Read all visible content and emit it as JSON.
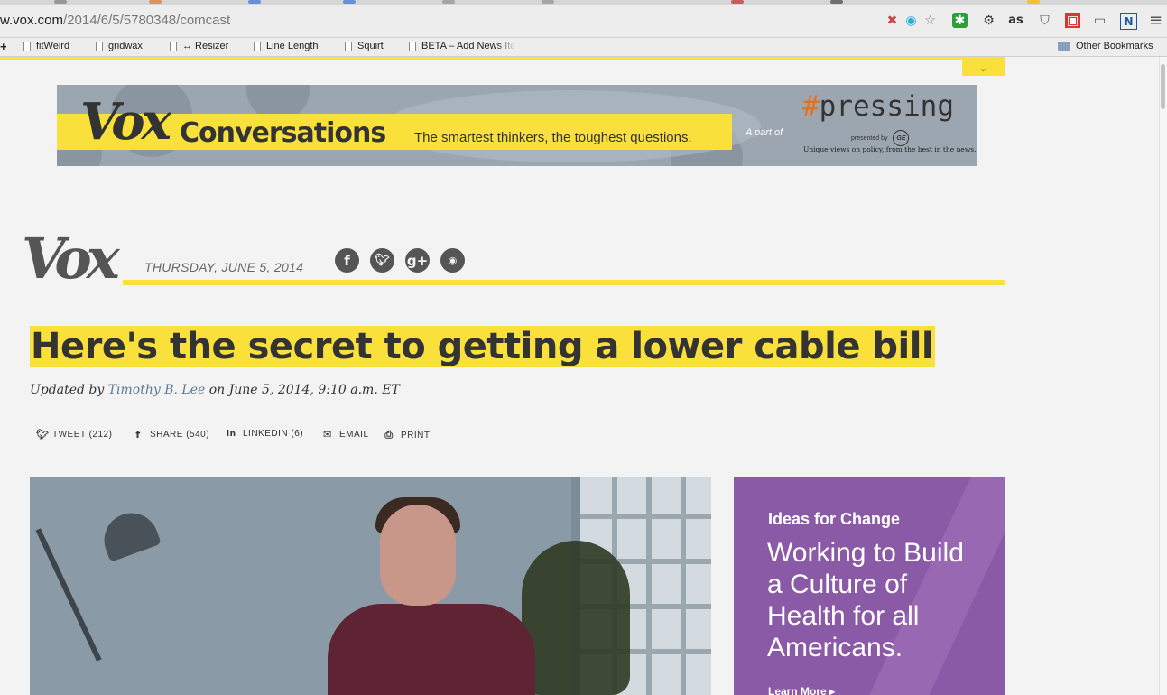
{
  "browser": {
    "url_host": "w.vox.com",
    "url_path": "/2014/6/5/5780348/comcast",
    "tab_colors": [
      "#888888",
      "#e08040",
      "#4a7fd8",
      "#4a7fd8",
      "#999999",
      "#999999",
      "#c04040",
      "#555555",
      "#f0c000"
    ],
    "extensions": [
      {
        "name": "blocked-icon",
        "glyph": "✖",
        "color": "#c44"
      },
      {
        "name": "circle-o-icon",
        "glyph": "◉",
        "color": "#2aa8e0"
      },
      {
        "name": "star-icon",
        "glyph": "☆",
        "color": "#777"
      },
      {
        "name": "evernote-icon",
        "glyph": "✱",
        "color": "#2f9e3a"
      },
      {
        "name": "gear-icon",
        "glyph": "⚙",
        "color": "#333"
      },
      {
        "name": "lastfm-icon",
        "glyph": "as",
        "color": "#333"
      },
      {
        "name": "pocket-icon",
        "glyph": "⛉",
        "color": "#555"
      },
      {
        "name": "red-square-icon",
        "glyph": "▣",
        "color": "#d33"
      },
      {
        "name": "cast-icon",
        "glyph": "▭",
        "color": "#555"
      },
      {
        "name": "n-icon",
        "glyph": "N",
        "color": "#1a56a8"
      },
      {
        "name": "menu-icon",
        "glyph": "≡",
        "color": "#555"
      }
    ],
    "bookmarks": [
      {
        "label": "fitWeird",
        "icon": "page"
      },
      {
        "label": "gridwax",
        "icon": "page"
      },
      {
        "label": "↔ Resizer",
        "icon": "page"
      },
      {
        "label": "Line Length",
        "icon": "page"
      },
      {
        "label": "Squirt",
        "icon": "page"
      },
      {
        "label": "BETA – Add News Ite",
        "icon": "page"
      }
    ],
    "other_bookmarks": "Other Bookmarks",
    "add_glyph": "+"
  },
  "banner": {
    "logo": "Vox",
    "title": "Conversations",
    "tagline": "The smartest thinkers, the toughest questions.",
    "part_of": "A part of",
    "pressing_hash": "#",
    "pressing_word": "pressing",
    "presented_by": "presented by",
    "sponsor_mark": "GE",
    "unique": "Unique views on policy, from the best in the news."
  },
  "masthead": {
    "logo": "Vox",
    "date": "THURSDAY, JUNE 5, 2014",
    "social": [
      {
        "name": "facebook-icon",
        "glyph": "f"
      },
      {
        "name": "twitter-icon",
        "glyph": "🐦︎"
      },
      {
        "name": "googleplus-icon",
        "glyph": "g+"
      },
      {
        "name": "rss-icon",
        "glyph": "◉"
      }
    ],
    "toggle_glyph": "⌄"
  },
  "article": {
    "headline": "Here's the secret to getting a lower cable bill",
    "updated_by": "Updated by",
    "author": "Timothy B. Lee",
    "dateline": "on June 5, 2014, 9:10 a.m. ET",
    "share": [
      {
        "icon": "twitter-icon",
        "glyph": "🐦︎",
        "label": "TWEET (212)"
      },
      {
        "icon": "facebook-icon",
        "glyph": "f",
        "label": "SHARE (540)"
      },
      {
        "icon": "linkedin-icon",
        "glyph": "in",
        "label": "LINKEDIN (6)"
      },
      {
        "icon": "email-icon",
        "glyph": "✉",
        "label": "EMAIL"
      },
      {
        "icon": "print-icon",
        "glyph": "⎙",
        "label": "PRINT"
      }
    ]
  },
  "ad": {
    "kicker": "Ideas for Change",
    "body": "Working to Build a Culture of Health for all Americans.",
    "cta": "Learn More ▸"
  }
}
